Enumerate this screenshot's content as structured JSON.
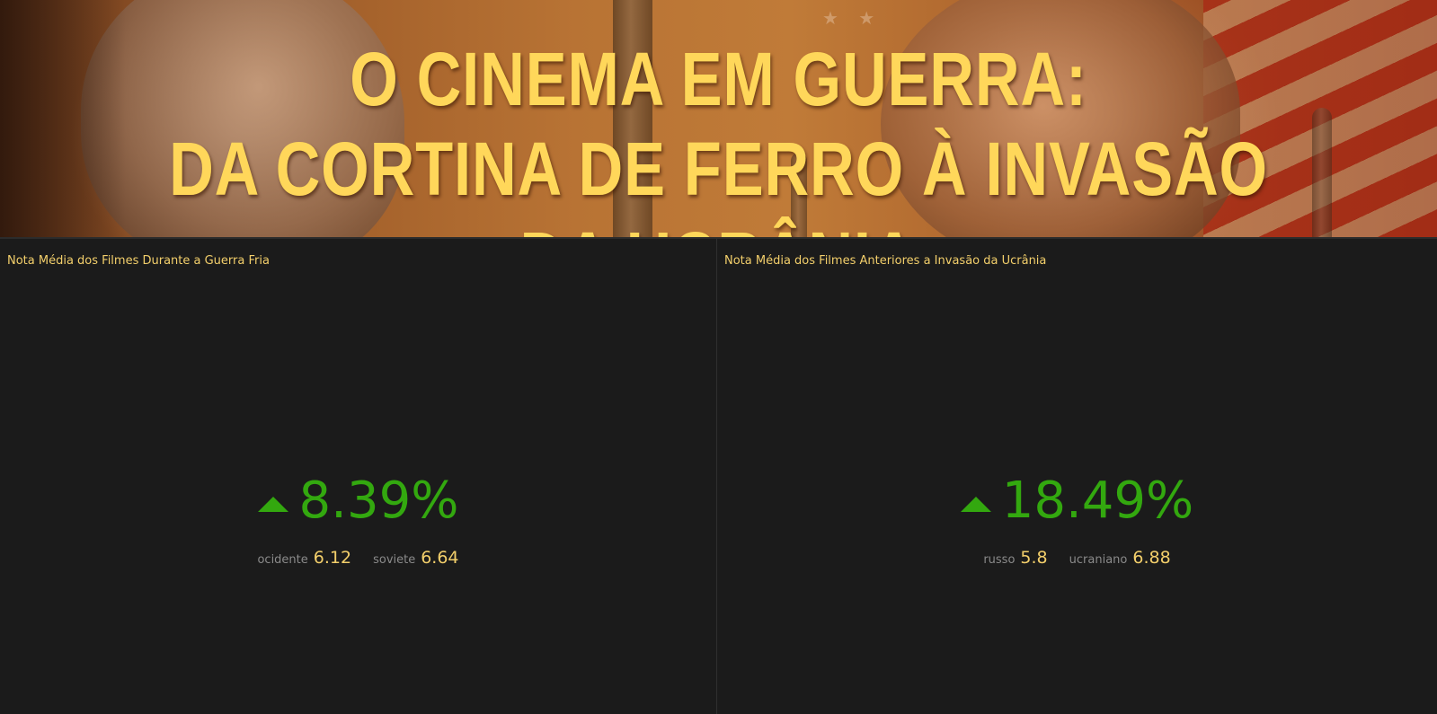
{
  "banner": {
    "title_line1": "O Cinema em Guerra:",
    "title_line2": "Da Cortina de Ferro à Invasão da Ucrânia"
  },
  "panels": [
    {
      "title": "Nota Média dos Filmes Durante a Guerra Fria",
      "kpi_value": "8.39%",
      "trend": "up",
      "compare": [
        {
          "label": "ocidente",
          "value": "6.12"
        },
        {
          "label": "soviete",
          "value": "6.64"
        }
      ]
    },
    {
      "title": "Nota Média dos Filmes Anteriores a Invasão da Ucrânia",
      "kpi_value": "18.49%",
      "trend": "up",
      "compare": [
        {
          "label": "russo",
          "value": "5.8"
        },
        {
          "label": "ucraniano",
          "value": "6.88"
        }
      ]
    }
  ],
  "colors": {
    "accent_gold": "#f3cf6b",
    "positive_green": "#33a80f",
    "background": "#1b1b1b"
  }
}
